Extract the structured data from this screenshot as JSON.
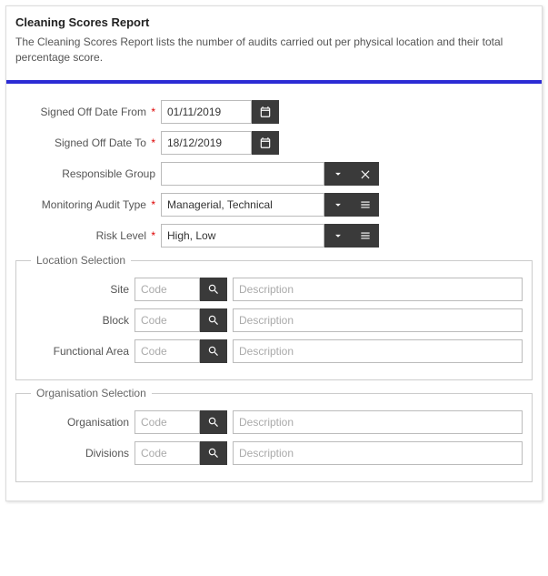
{
  "header": {
    "title": "Cleaning Scores Report",
    "description": "The Cleaning Scores Report lists the number of audits carried out per physical location and their total percentage score."
  },
  "fields": {
    "date_from": {
      "label": "Signed Off Date From",
      "value": "01/11/2019",
      "required": true
    },
    "date_to": {
      "label": "Signed Off Date To",
      "value": "18/12/2019",
      "required": true
    },
    "responsible_group": {
      "label": "Responsible Group",
      "value": ""
    },
    "audit_type": {
      "label": "Monitoring Audit Type",
      "value": "Managerial, Technical",
      "required": true
    },
    "risk_level": {
      "label": "Risk Level",
      "value": "High, Low",
      "required": true
    }
  },
  "location": {
    "legend": "Location Selection",
    "rows": {
      "site": {
        "label": "Site",
        "code_placeholder": "Code",
        "desc_placeholder": "Description"
      },
      "block": {
        "label": "Block",
        "code_placeholder": "Code",
        "desc_placeholder": "Description"
      },
      "functional_area": {
        "label": "Functional Area",
        "code_placeholder": "Code",
        "desc_placeholder": "Description"
      }
    }
  },
  "organisation": {
    "legend": "Organisation Selection",
    "rows": {
      "organisation": {
        "label": "Organisation",
        "code_placeholder": "Code",
        "desc_placeholder": "Description"
      },
      "divisions": {
        "label": "Divisions",
        "code_placeholder": "Code",
        "desc_placeholder": "Description"
      }
    }
  }
}
